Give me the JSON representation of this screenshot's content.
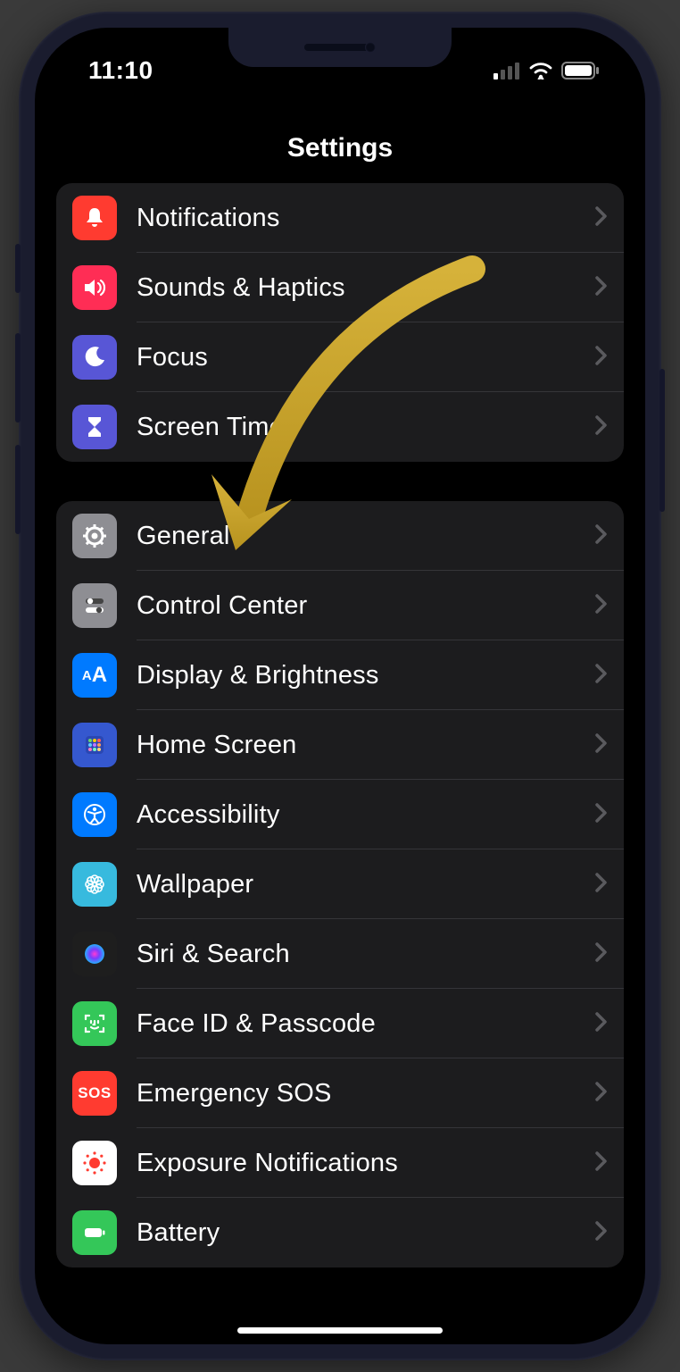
{
  "statusBar": {
    "time": "11:10"
  },
  "header": {
    "title": "Settings"
  },
  "sections": [
    {
      "rows": [
        {
          "icon": "bell-icon",
          "iconColor": "#ff3b30",
          "label": "Notifications"
        },
        {
          "icon": "speaker-icon",
          "iconColor": "#ff2d55",
          "label": "Sounds & Haptics"
        },
        {
          "icon": "moon-icon",
          "iconColor": "#5856d6",
          "label": "Focus"
        },
        {
          "icon": "hourglass-icon",
          "iconColor": "#5856d6",
          "label": "Screen Time"
        }
      ]
    },
    {
      "rows": [
        {
          "icon": "gear-icon",
          "iconColor": "#8e8e93",
          "label": "General"
        },
        {
          "icon": "switches-icon",
          "iconColor": "#8e8e93",
          "label": "Control Center"
        },
        {
          "icon": "text-size-icon",
          "iconColor": "#007aff",
          "label": "Display & Brightness"
        },
        {
          "icon": "grid-icon",
          "iconColor": "#3558cf",
          "label": "Home Screen"
        },
        {
          "icon": "accessibility-icon",
          "iconColor": "#007aff",
          "label": "Accessibility"
        },
        {
          "icon": "flower-icon",
          "iconColor": "#37bade",
          "label": "Wallpaper"
        },
        {
          "icon": "siri-icon",
          "iconColor": "#1e1e1e",
          "label": "Siri & Search"
        },
        {
          "icon": "faceid-icon",
          "iconColor": "#34c759",
          "label": "Face ID & Passcode"
        },
        {
          "icon": "sos-icon",
          "iconColor": "#ff3b30",
          "label": "Emergency SOS"
        },
        {
          "icon": "exposure-icon",
          "iconColor": "#ffffff",
          "label": "Exposure Notifications"
        },
        {
          "icon": "battery-icon",
          "iconColor": "#34c759",
          "label": "Battery"
        }
      ]
    }
  ],
  "annotation": {
    "arrowColor": "#c9a227"
  }
}
